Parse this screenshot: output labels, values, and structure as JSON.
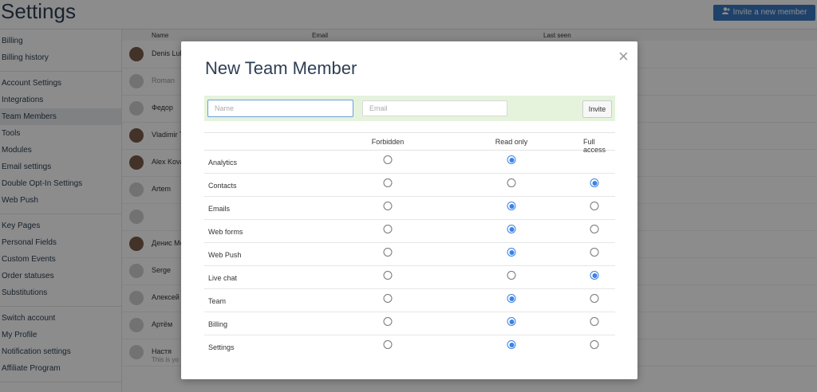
{
  "app": {
    "title": "Settings",
    "invite_button": "Invite a new member"
  },
  "sidebar": {
    "groups": [
      [
        "Billing",
        "Billing history"
      ],
      [
        "Account Settings",
        "Integrations",
        "Team Members",
        "Tools",
        "Modules",
        "Email settings",
        "Double Opt-In Settings",
        "Web Push"
      ],
      [
        "Key Pages",
        "Personal Fields",
        "Custom Events",
        "Order statuses",
        "Substitutions"
      ],
      [
        "Switch account",
        "My Profile",
        "Notification settings",
        "Affiliate Program"
      ]
    ],
    "active": "Team Members"
  },
  "table": {
    "headers": {
      "name": "Name",
      "email": "Email",
      "last_seen": "Last seen"
    },
    "rows": [
      {
        "name": "Denis Luk",
        "photo": true,
        "muted": false,
        "sub": ""
      },
      {
        "name": "Roman",
        "photo": false,
        "muted": true,
        "sub": ""
      },
      {
        "name": "Федор",
        "photo": false,
        "muted": false,
        "sub": ""
      },
      {
        "name": "Vladimir T",
        "photo": true,
        "muted": false,
        "sub": ""
      },
      {
        "name": "Alex Kova",
        "photo": true,
        "muted": false,
        "sub": ""
      },
      {
        "name": "Artem",
        "photo": false,
        "muted": false,
        "sub": ""
      },
      {
        "name": "",
        "photo": false,
        "muted": false,
        "sub": ""
      },
      {
        "name": "Денис Ме",
        "photo": true,
        "muted": false,
        "sub": ""
      },
      {
        "name": "Serge",
        "photo": false,
        "muted": false,
        "sub": ""
      },
      {
        "name": "Алексей",
        "photo": false,
        "muted": false,
        "sub": ""
      },
      {
        "name": "Артём",
        "photo": false,
        "muted": false,
        "sub": ""
      },
      {
        "name": "Настя",
        "photo": false,
        "muted": false,
        "sub": "This is yo"
      }
    ]
  },
  "modal": {
    "title": "New Team Member",
    "close_icon": "×",
    "name_placeholder": "Name",
    "email_placeholder": "Email",
    "invite_label": "Invite",
    "columns": [
      "Forbidden",
      "Read only",
      "Full access"
    ],
    "permissions": [
      {
        "label": "Analytics",
        "options": 2,
        "selected": 1
      },
      {
        "label": "Contacts",
        "options": 3,
        "selected": 2
      },
      {
        "label": "Emails",
        "options": 3,
        "selected": 1
      },
      {
        "label": "Web forms",
        "options": 3,
        "selected": 1
      },
      {
        "label": "Web Push",
        "options": 3,
        "selected": 1
      },
      {
        "label": "Live chat",
        "options": 3,
        "selected": 2
      },
      {
        "label": "Team",
        "options": 3,
        "selected": 1
      },
      {
        "label": "Billing",
        "options": 3,
        "selected": 1
      },
      {
        "label": "Settings",
        "options": 3,
        "selected": 1
      }
    ]
  },
  "colors": {
    "accent": "#3a78c3",
    "radio_selected": "#3b82e6",
    "invite_bar": "#e5f3dd"
  }
}
